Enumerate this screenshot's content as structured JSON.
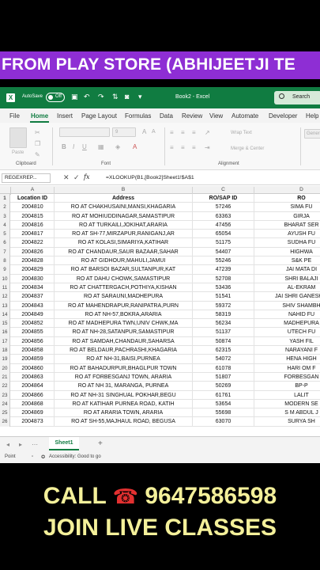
{
  "banner": {
    "text": "FROM PLAY STORE (ABHIJEETJI TE"
  },
  "titlebar": {
    "autosave_label": "AutoSave",
    "autosave_state": "Off",
    "file_name": "Book2 - Excel",
    "search_placeholder": "Search"
  },
  "menu": {
    "items": [
      "File",
      "Home",
      "Insert",
      "Page Layout",
      "Formulas",
      "Data",
      "Review",
      "View",
      "Automate",
      "Developer",
      "Help"
    ],
    "active": "Home"
  },
  "ribbon": {
    "groups": [
      "Clipboard",
      "Font",
      "Alignment"
    ],
    "paste_label": "Paste",
    "font_size": "9",
    "wrap_text": "Wrap Text",
    "merge_center": "Merge & Center",
    "number_format": "Gener"
  },
  "formula_bar": {
    "name_box": "REGEXREP...",
    "formula": "=XLOOKUP(B1,[Book2]Sheet1!$A$1"
  },
  "columns": [
    "A",
    "B",
    "C",
    "D"
  ],
  "table": {
    "headers": [
      "Location ID",
      "Address",
      "RO/SAP ID",
      "RO"
    ],
    "rows": [
      [
        "2004810",
        "RO AT CHAKHUSAINI,MANSI,KHAGARIA",
        "57246",
        "SIMA FU"
      ],
      [
        "2004815",
        "RO AT MOHIUDDINAGAR,SAMASTIPUR",
        "63363",
        "GIRJA"
      ],
      [
        "2004816",
        "RO AT TURKAILI,JOKIHAT,ARARIA",
        "47456",
        "BHARAT SER"
      ],
      [
        "2004817",
        "RO AT SH-77,MIRZAPUR,RANIGANJ,AR",
        "65054",
        "AYUSH FU"
      ],
      [
        "2004822",
        "RO AT KOLASI,SIMARIYA,KATIHAR",
        "51175",
        "SUDHA FU"
      ],
      [
        "2004826",
        "RO AT CHANDAUR,SAUR BAZAAR,SAHAR",
        "54407",
        "HIGHWA"
      ],
      [
        "2004828",
        "RO AT GIDHOUR,MAHULI,JAMUI",
        "55246",
        "S&K PE"
      ],
      [
        "2004829",
        "RO AT BARSOI BAZAR,SULTANPUR,KAT",
        "47239",
        "JAI MATA DI"
      ],
      [
        "2004830",
        "RO AT DAHU CHOWK,SAMASTIPUR",
        "52708",
        "SHRI BALAJI"
      ],
      [
        "2004834",
        "RO AT CHATTERGACH,POTHIYA,KISHAN",
        "53436",
        "AL-EKRAM"
      ],
      [
        "2004837",
        "RO AT SARAUNI,MADHEPURA",
        "51541",
        "JAI SHRI GANESH S"
      ],
      [
        "2004843",
        "RO AT MAHENDRAPUR,RANIPATRA,PURN",
        "59372",
        "SHIV SHAMBH"
      ],
      [
        "2004849",
        "RO AT NH-57,BOKRA,ARARIA",
        "58319",
        "NAHID FU"
      ],
      [
        "2004852",
        "RO AT MADHEPURA TWN,UNIV CHWK,MA",
        "56234",
        "MADHEPURA"
      ],
      [
        "2004855",
        "RO AT NH-28,SATANPUR,SAMASTIPUR",
        "51137",
        "UTECH FU"
      ],
      [
        "2004856",
        "RO AT SAMDAH,CHANDAUR,SAHARSA",
        "50874",
        "YASH FIL"
      ],
      [
        "2004858",
        "RO AT BELDAUR,PACHRASHI,KHAGARIA",
        "62315",
        "NARAYANI F"
      ],
      [
        "2004859",
        "RO AT NH-31,BAISI,PURNEA",
        "54072",
        "HENA HIGH"
      ],
      [
        "2004860",
        "RO AT BAHADURPUR,BHAGLPUR TOWN",
        "61078",
        "HARI OM F"
      ],
      [
        "2004863",
        "RO AT FORBESGANJ TOWN, ARARIA",
        "51807",
        "FORBESGAN"
      ],
      [
        "2004864",
        "RO AT NH 31, MARANGA, PURNEA",
        "50269",
        "BP-P"
      ],
      [
        "2004866",
        "RO AT NH-31 SINGHUAL POKHAR,BEGU",
        "61761",
        "LALIT"
      ],
      [
        "2004868",
        "RO AT KATIHAR PURNEA ROAD, KATIH",
        "53654",
        "MODERN SE"
      ],
      [
        "2004869",
        "RO AT ARARIA TOWN, ARARIA",
        "55698",
        "S M ABDUL J"
      ],
      [
        "2004873",
        "RO AT SH-55,MAJHAUL ROAD, BEGUSA",
        "63070",
        "SURYA SH"
      ]
    ]
  },
  "sheet_tab": "Sheet1",
  "status": {
    "mode": "Point",
    "accessibility": "Accessibility: Good to go"
  },
  "cta": {
    "call_label": "CALL",
    "phone_icon_glyph": "☎",
    "phone_number": "9647586598",
    "line2": "JOIN LIVE CLASSES"
  },
  "colors": {
    "banner": "#8e2ed4",
    "excel_green": "#107c41",
    "cta_text": "#f4f09a",
    "phone_icon": "#e23030"
  }
}
